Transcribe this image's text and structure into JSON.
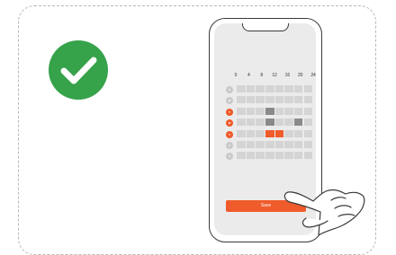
{
  "icons": {
    "check": "checkmark-icon",
    "hand": "pointing-hand-icon"
  },
  "colors": {
    "check_green": "#36a24a",
    "accent_orange": "#ef5b2a",
    "cell_grey": "#d4d4d4",
    "cell_selected": "#8a8a8a"
  },
  "schedule": {
    "hour_labels": [
      "0",
      "4",
      "8",
      "12",
      "16",
      "20",
      "24"
    ],
    "rows": [
      {
        "day": "S",
        "active": false,
        "on": [],
        "hl": []
      },
      {
        "day": "M",
        "active": false,
        "on": [],
        "hl": []
      },
      {
        "day": "T",
        "active": true,
        "on": [
          3
        ],
        "hl": []
      },
      {
        "day": "W",
        "active": true,
        "on": [
          3,
          6
        ],
        "hl": []
      },
      {
        "day": "T",
        "active": true,
        "on": [],
        "hl": [
          3,
          4
        ]
      },
      {
        "day": "F",
        "active": false,
        "on": [],
        "hl": []
      },
      {
        "day": "S",
        "active": false,
        "on": [],
        "hl": []
      }
    ]
  },
  "save_label": "Save"
}
